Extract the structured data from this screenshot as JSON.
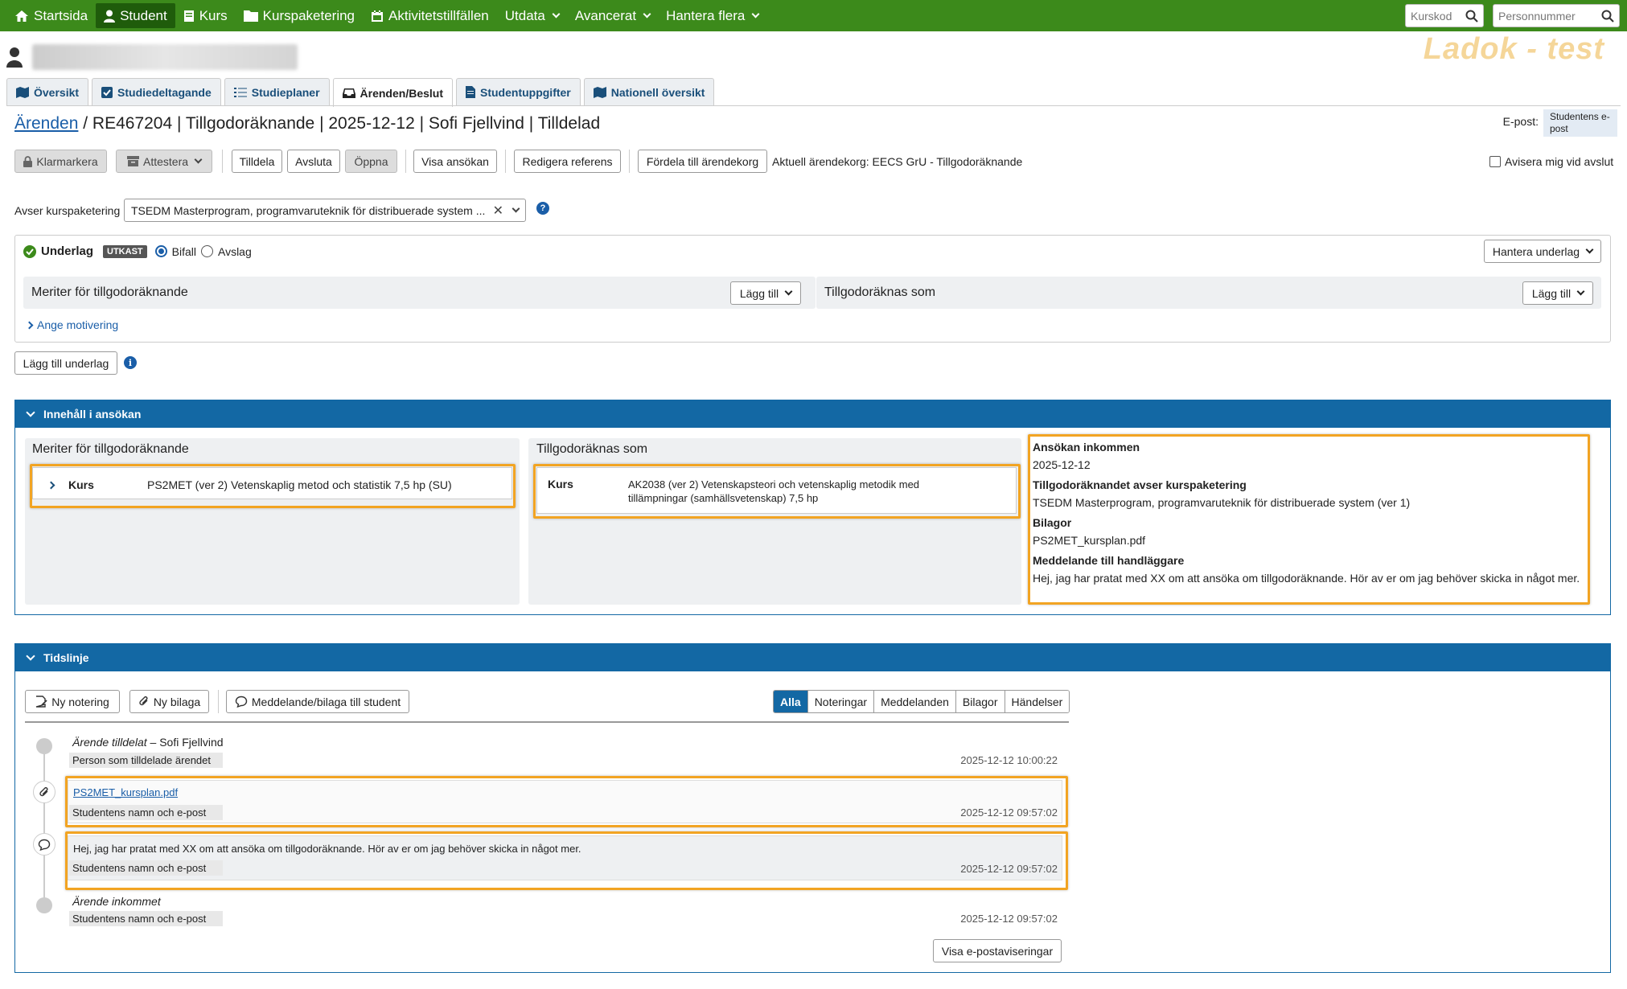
{
  "topnav": {
    "items": [
      {
        "label": "Startsida",
        "icon": "home-icon"
      },
      {
        "label": "Student",
        "icon": "user-icon",
        "active": true
      },
      {
        "label": "Kurs",
        "icon": "book-icon"
      },
      {
        "label": "Kurspaketering",
        "icon": "folder-icon"
      },
      {
        "label": "Aktivitetstillfällen",
        "icon": "calendar-icon"
      },
      {
        "label": "Utdata",
        "dropdown": true
      },
      {
        "label": "Avancerat",
        "dropdown": true
      },
      {
        "label": "Hantera flera",
        "dropdown": true
      }
    ],
    "kurskod_placeholder": "Kurskod",
    "personnummer_placeholder": "Personnummer",
    "color": "#3c8a1b"
  },
  "env_label": "Ladok - test",
  "tabs": [
    {
      "label": "Översikt"
    },
    {
      "label": "Studiedeltagande"
    },
    {
      "label": "Studieplaner"
    },
    {
      "label": "Ärenden/Beslut",
      "active": true
    },
    {
      "label": "Studentuppgifter"
    },
    {
      "label": "Nationell översikt"
    }
  ],
  "breadcrumb": {
    "link": "Ärenden",
    "rest": " / RE467204 | Tillgodoräknande | 2025-12-12 | Sofi Fjellvind | Tilldelad"
  },
  "epost": {
    "label": "E-post:",
    "value": "Studentens e-post"
  },
  "toolbar": {
    "klarmarkera": "Klarmarkera",
    "attestera": "Attestera",
    "tilldela": "Tilldela",
    "avsluta": "Avsluta",
    "oppna": "Öppna",
    "visa_ansokan": "Visa ansökan",
    "redigera_referens": "Redigera referens",
    "fordela": "Fördela till ärendekorg",
    "korg_text": "Aktuell ärendekorg: EECS GrU - Tillgodoräknande",
    "avisera": "Avisera mig vid avslut"
  },
  "kurspaketering": {
    "label": "Avser kurspaketering",
    "value": "TSEDM Masterprogram, programvaruteknik för distribuerade system ..."
  },
  "underlag": {
    "title": "Underlag",
    "badge": "UTKAST",
    "bifall": "Bifall",
    "avslag": "Avslag",
    "selected": "Bifall",
    "hantera": "Hantera underlag",
    "meriter": "Meriter för tillgodoräknande",
    "tillgodo": "Tillgodoräknas som",
    "lagg_till": "Lägg till",
    "motivering": "Ange motivering",
    "lagg_till_underlag": "Lägg till underlag"
  },
  "innehall": {
    "header": "Innehåll i ansökan",
    "meriter_title": "Meriter för tillgodoräknande",
    "merit": {
      "type": "Kurs",
      "text": "PS2MET (ver 2) Vetenskaplig metod och statistik 7,5 hp (SU)"
    },
    "tillgodo_title": "Tillgodoräknas som",
    "tillgodo": {
      "type": "Kurs",
      "text": "AK2038  (ver 2) Vetenskapsteori och vetenskaplig metodik med tillämpningar (samhällsvetenskap) 7,5 hp"
    },
    "info": [
      {
        "title": "Ansökan inkommen",
        "value": "2025-12-12"
      },
      {
        "title": "Tillgodoräknandet avser kurspaketering",
        "value": "TSEDM Masterprogram, programvaruteknik för distribuerade system (ver 1)"
      },
      {
        "title": "Bilagor",
        "value": "PS2MET_kursplan.pdf"
      },
      {
        "title": "Meddelande till handläggare",
        "value": "Hej, jag har pratat med XX om att ansöka om tillgodoräknande. Hör av er om jag behöver skicka in något mer."
      }
    ]
  },
  "tidslinje": {
    "header": "Tidslinje",
    "ny_notering": "Ny notering",
    "ny_bilaga": "Ny bilaga",
    "meddelande": "Meddelande/bilaga till student",
    "filters": [
      "Alla",
      "Noteringar",
      "Meddelanden",
      "Bilagor",
      "Händelser"
    ],
    "active_filter": "Alla",
    "events": [
      {
        "title": "Ärende tilldelat",
        "suffix": " – Sofi Fjellvind",
        "who": "Person som tilldelade ärendet",
        "time": "2025-12-12 10:00:22"
      },
      {
        "link": "PS2MET_kursplan.pdf",
        "who": "Studentens namn och e-post",
        "time": "2025-12-12 09:57:02"
      },
      {
        "text": "Hej, jag har pratat med XX om att ansöka om tillgodoräknande. Hör av er om jag behöver skicka in något mer.",
        "who": "Studentens namn och e-post",
        "time": "2025-12-12 09:57:02"
      },
      {
        "title": "Ärende inkommet",
        "who": "Studentens namn och e-post",
        "time": "2025-12-12 09:57:02"
      }
    ],
    "visa_epost": "Visa e-postaviseringar"
  }
}
